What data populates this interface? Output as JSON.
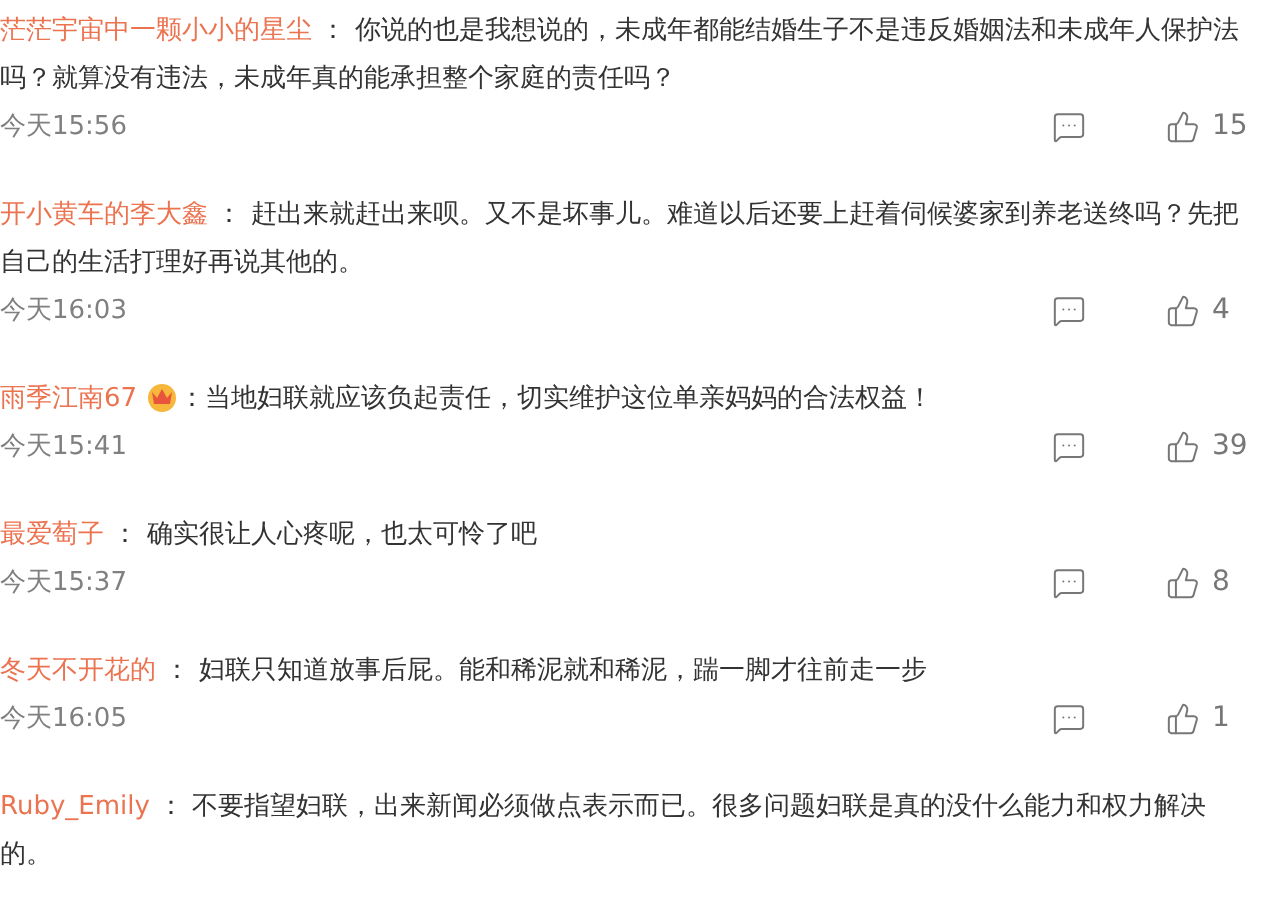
{
  "comments": [
    {
      "author": "茫茫宇宙中一颗小小的星尘",
      "vip_badge": false,
      "text": " ： 你说的也是我想说的，未成年都能结婚生子不是违反婚姻法和未成年人保护法吗？就算没有违法，未成年真的能承担整个家庭的责任吗？",
      "time": "今天15:56",
      "likes": "15"
    },
    {
      "author": "开小黄车的李大鑫",
      "vip_badge": false,
      "text": " ： 赶出来就赶出来呗。又不是坏事儿。难道以后还要上赶着伺候婆家到养老送终吗？先把自己的生活打理好再说其他的。",
      "time": "今天16:03",
      "likes": "4"
    },
    {
      "author": "雨季江南67",
      "vip_badge": true,
      "text": "：当地妇联就应该负起责任，切实维护这位单亲妈妈的合法权益！",
      "time": "今天15:41",
      "likes": "39"
    },
    {
      "author": "最爱萄子",
      "vip_badge": false,
      "text": " ： 确实很让人心疼呢，也太可怜了吧",
      "time": "今天15:37",
      "likes": "8"
    },
    {
      "author": "冬天不开花的",
      "vip_badge": false,
      "text": " ： 妇联只知道放事后屁。能和稀泥就和稀泥，踹一脚才往前走一步",
      "time": "今天16:05",
      "likes": "1"
    },
    {
      "author": "Ruby_Emily",
      "vip_badge": false,
      "text": " ： 不要指望妇联，出来新闻必须做点表示而已。很多问题妇联是真的没什么能力和权力解决的。"
    }
  ]
}
